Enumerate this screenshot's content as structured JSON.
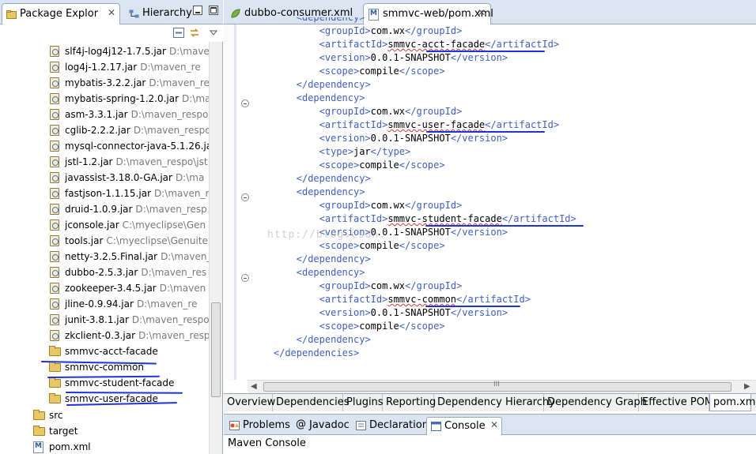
{
  "left_tabs": {
    "package_explorer": "Package Explor",
    "hierarchy": "Hierarchy",
    "close": "✕"
  },
  "tree": {
    "jars": [
      {
        "name": "slf4j-log4j12-1.7.5.jar",
        "path": "D:\\mave"
      },
      {
        "name": "log4j-1.2.17.jar",
        "path": "D:\\maven_re"
      },
      {
        "name": "mybatis-3.2.2.jar",
        "path": "D:\\maven_re"
      },
      {
        "name": "mybatis-spring-1.2.0.jar",
        "path": "D:\\ma"
      },
      {
        "name": "asm-3.3.1.jar",
        "path": "D:\\maven_respo"
      },
      {
        "name": "cglib-2.2.2.jar",
        "path": "D:\\maven_respo"
      },
      {
        "name": "mysql-connector-java-5.1.26.jar",
        "path": ""
      },
      {
        "name": "jstl-1.2.jar",
        "path": "D:\\maven_respo\\jst"
      },
      {
        "name": "javassist-3.18.0-GA.jar",
        "path": "D:\\ma"
      },
      {
        "name": "fastjson-1.1.15.jar",
        "path": "D:\\maven_r"
      },
      {
        "name": "druid-1.0.9.jar",
        "path": "D:\\maven_resp"
      },
      {
        "name": "jconsole.jar",
        "path": "C:\\myeclipse\\Gen"
      },
      {
        "name": "tools.jar",
        "path": "C:\\myeclipse\\Genuite"
      },
      {
        "name": "netty-3.2.5.Final.jar",
        "path": "D:\\maven_"
      },
      {
        "name": "dubbo-2.5.3.jar",
        "path": "D:\\maven_res"
      },
      {
        "name": "zookeeper-3.4.5.jar",
        "path": "D:\\maven"
      },
      {
        "name": "jline-0.9.94.jar",
        "path": "D:\\maven_re"
      },
      {
        "name": "junit-3.8.1.jar",
        "path": "D:\\maven_respo"
      },
      {
        "name": "zkclient-0.3.jar",
        "path": "D:\\maven_resp"
      }
    ],
    "projects": [
      "smmvc-acct-facade",
      "smmvc-common",
      "smmvc-student-facade",
      "smmvc-user-facade"
    ],
    "folders": [
      "src",
      "target"
    ],
    "file": "pom.xml"
  },
  "editor_tabs": {
    "consumer": "dubbo-consumer.xml",
    "pom": "smmvc-web/pom.xml",
    "close": "✕"
  },
  "code_lines": [
    {
      "indent": 4,
      "parts": [
        {
          "t": "tg",
          "v": "<dependency>"
        }
      ]
    },
    {
      "indent": 6,
      "parts": [
        {
          "t": "tg",
          "v": "<groupId>"
        },
        {
          "t": "tx",
          "v": "com.wx"
        },
        {
          "t": "tg",
          "v": "</groupId>"
        }
      ]
    },
    {
      "indent": 6,
      "parts": [
        {
          "t": "tg",
          "v": "<artifactId>"
        },
        {
          "t": "tx",
          "v": "smmvc-acct-facade",
          "s": 1
        },
        {
          "t": "tg",
          "v": "</artifactId>"
        }
      ]
    },
    {
      "indent": 6,
      "parts": [
        {
          "t": "tg",
          "v": "<version>"
        },
        {
          "t": "tx",
          "v": "0.0.1-SNAPSHOT"
        },
        {
          "t": "tg",
          "v": "</version>"
        }
      ]
    },
    {
      "indent": 6,
      "parts": [
        {
          "t": "tg",
          "v": "<scope>"
        },
        {
          "t": "tx",
          "v": "compile"
        },
        {
          "t": "tg",
          "v": "</scope>"
        }
      ]
    },
    {
      "indent": 4,
      "parts": [
        {
          "t": "tg",
          "v": "</dependency>"
        }
      ]
    },
    {
      "indent": 4,
      "parts": [
        {
          "t": "tg",
          "v": "<dependency>"
        }
      ]
    },
    {
      "indent": 6,
      "parts": [
        {
          "t": "tg",
          "v": "<groupId>"
        },
        {
          "t": "tx",
          "v": "com.wx"
        },
        {
          "t": "tg",
          "v": "</groupId>"
        }
      ]
    },
    {
      "indent": 6,
      "parts": [
        {
          "t": "tg",
          "v": "<artifactId>"
        },
        {
          "t": "tx",
          "v": "smmvc-user-facade",
          "s": 1
        },
        {
          "t": "tg",
          "v": "</artifactId>"
        }
      ]
    },
    {
      "indent": 6,
      "parts": [
        {
          "t": "tg",
          "v": "<version>"
        },
        {
          "t": "tx",
          "v": "0.0.1-SNAPSHOT"
        },
        {
          "t": "tg",
          "v": "</version>"
        }
      ]
    },
    {
      "indent": 6,
      "parts": [
        {
          "t": "tg",
          "v": "<type>"
        },
        {
          "t": "tx",
          "v": "jar"
        },
        {
          "t": "tg",
          "v": "</type>"
        }
      ]
    },
    {
      "indent": 6,
      "parts": [
        {
          "t": "tg",
          "v": "<scope>"
        },
        {
          "t": "tx",
          "v": "compile"
        },
        {
          "t": "tg",
          "v": "</scope>"
        }
      ]
    },
    {
      "indent": 4,
      "parts": [
        {
          "t": "tg",
          "v": "</dependency>"
        }
      ]
    },
    {
      "indent": 4,
      "parts": [
        {
          "t": "tg",
          "v": "<dependency>"
        }
      ]
    },
    {
      "indent": 6,
      "parts": [
        {
          "t": "tg",
          "v": "<groupId>"
        },
        {
          "t": "tx",
          "v": "com.wx"
        },
        {
          "t": "tg",
          "v": "</groupId>"
        }
      ]
    },
    {
      "indent": 6,
      "parts": [
        {
          "t": "tg",
          "v": "<artifactId>"
        },
        {
          "t": "tx",
          "v": "smmvc-student-facade",
          "s": 1
        },
        {
          "t": "tg",
          "v": "</artifactId>"
        }
      ]
    },
    {
      "indent": 6,
      "parts": [
        {
          "t": "tg",
          "v": "<version>"
        },
        {
          "t": "tx",
          "v": "0.0.1-SNAPSHOT"
        },
        {
          "t": "tg",
          "v": "</version>"
        }
      ]
    },
    {
      "indent": 6,
      "parts": [
        {
          "t": "tg",
          "v": "<scope>"
        },
        {
          "t": "tx",
          "v": "compile"
        },
        {
          "t": "tg",
          "v": "</scope>"
        }
      ]
    },
    {
      "indent": 4,
      "parts": [
        {
          "t": "tg",
          "v": "</dependency>"
        }
      ]
    },
    {
      "indent": 4,
      "parts": [
        {
          "t": "tg",
          "v": "<dependency>"
        }
      ]
    },
    {
      "indent": 6,
      "parts": [
        {
          "t": "tg",
          "v": "<groupId>"
        },
        {
          "t": "tx",
          "v": "com.wx"
        },
        {
          "t": "tg",
          "v": "</groupId>"
        }
      ]
    },
    {
      "indent": 6,
      "parts": [
        {
          "t": "tg",
          "v": "<artifactId>"
        },
        {
          "t": "tx",
          "v": "smmvc-common",
          "s": 1
        },
        {
          "t": "tg",
          "v": "</artifactId>"
        }
      ]
    },
    {
      "indent": 6,
      "parts": [
        {
          "t": "tg",
          "v": "<version>"
        },
        {
          "t": "tx",
          "v": "0.0.1-SNAPSHOT"
        },
        {
          "t": "tg",
          "v": "</version>"
        }
      ]
    },
    {
      "indent": 6,
      "parts": [
        {
          "t": "tg",
          "v": "<scope>"
        },
        {
          "t": "tx",
          "v": "compile"
        },
        {
          "t": "tg",
          "v": "</scope>"
        }
      ]
    },
    {
      "indent": 4,
      "parts": [
        {
          "t": "tg",
          "v": "</dependency>"
        }
      ]
    },
    {
      "indent": 2,
      "parts": [
        {
          "t": "tg",
          "v": "</dependencies>"
        }
      ]
    }
  ],
  "watermark": "http://blog.csdn.",
  "pom_tabs": [
    "Overview",
    "Dependencies",
    "Plugins",
    "Reporting",
    "Dependency Hierarchy",
    "Dependency Graph",
    "Effective POM",
    "pom.xml"
  ],
  "console_tabs": {
    "problems": "Problems",
    "javadoc": "Javadoc",
    "declaration": "Declaration",
    "console": "Console",
    "close": "✕"
  },
  "console_title": "Maven Console",
  "colors": {
    "tag": "#3f5fbf",
    "annotation": "#1f33d8",
    "tab_bar": "#dbe5f1"
  }
}
